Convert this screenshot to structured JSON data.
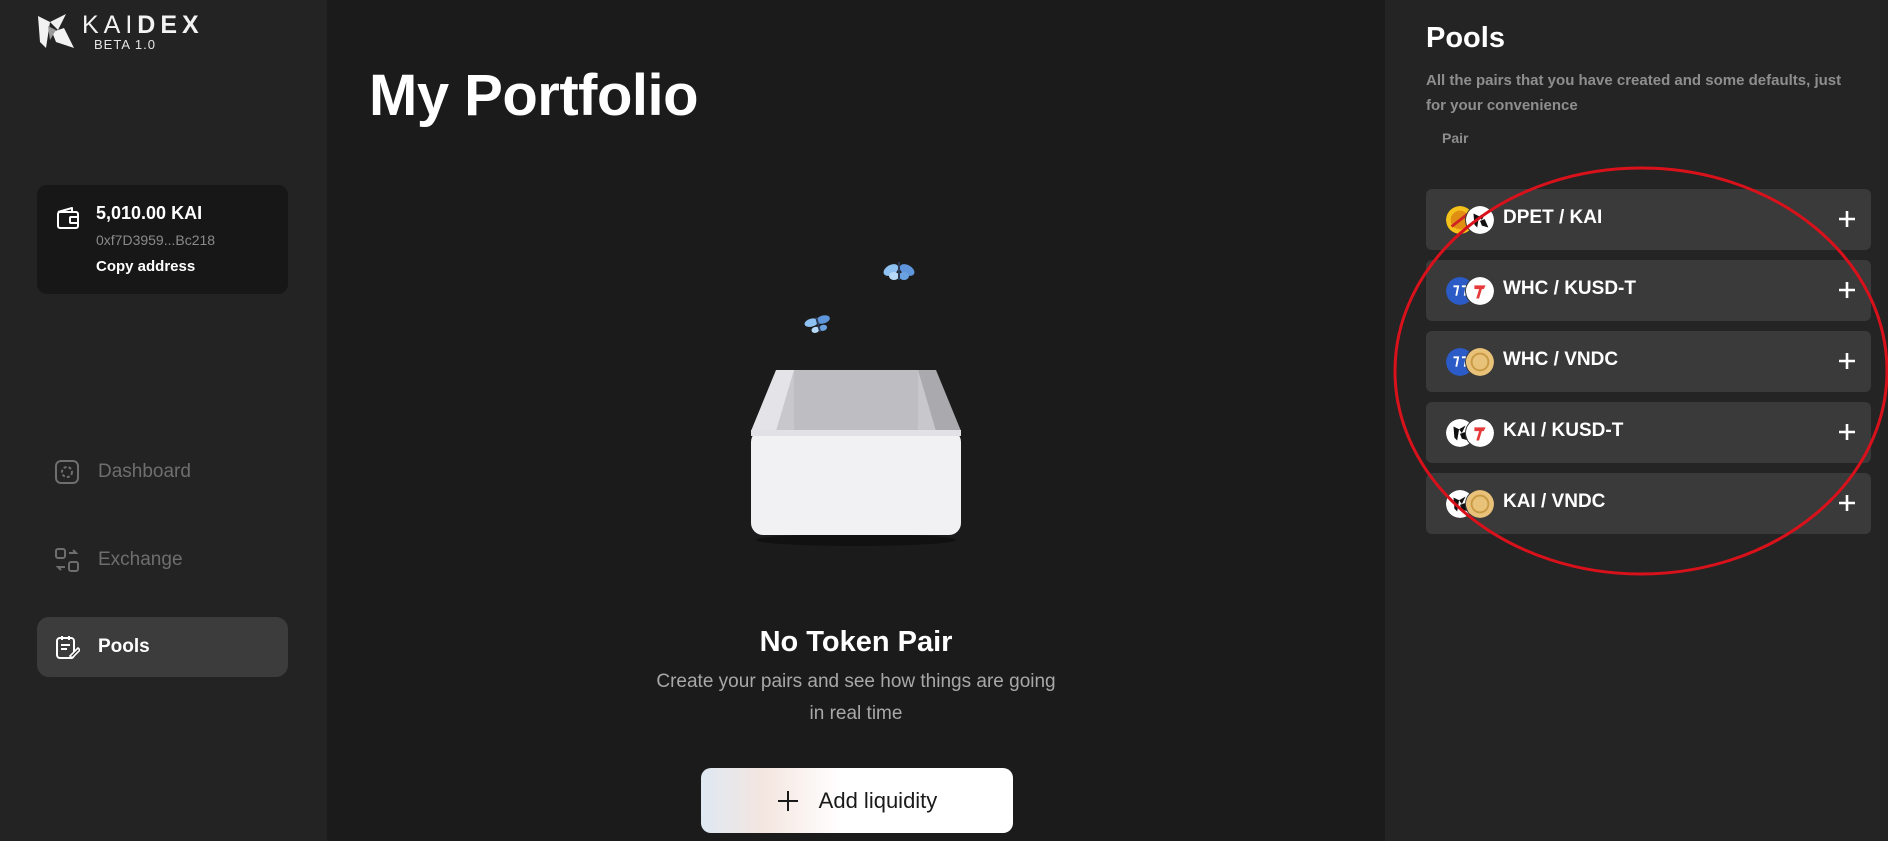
{
  "brand": {
    "name_light": "KAI",
    "name_bold": "DEX",
    "version": "BETA 1.0"
  },
  "wallet": {
    "balance": "5,010.00 KAI",
    "address": "0xf7D3959...Bc218",
    "copy_label": "Copy address"
  },
  "nav": {
    "items": [
      {
        "label": "Dashboard",
        "icon": "dashboard-icon",
        "active": false
      },
      {
        "label": "Exchange",
        "icon": "exchange-icon",
        "active": false
      },
      {
        "label": "Pools",
        "icon": "pools-icon",
        "active": true
      }
    ]
  },
  "main": {
    "title": "My Portfolio",
    "empty_title": "No Token Pair",
    "empty_text": "Create your pairs and see how things are going in real time",
    "add_button": "Add liquidity"
  },
  "pools_panel": {
    "title": "Pools",
    "subtitle": "All the pairs that you have created and some defaults, just for your convenience",
    "column_header": "Pair",
    "pairs": [
      {
        "label": "DPET / KAI",
        "token_a": "dpet-token-icon",
        "token_b": "kai-token-icon"
      },
      {
        "label": "WHC / KUSD-T",
        "token_a": "whc-token-icon",
        "token_b": "kusd-t-token-icon"
      },
      {
        "label": "WHC / VNDC",
        "token_a": "whc-token-icon",
        "token_b": "vndc-token-icon"
      },
      {
        "label": "KAI / KUSD-T",
        "token_a": "kai-token-icon",
        "token_b": "kusd-t-token-icon"
      },
      {
        "label": "KAI / VNDC",
        "token_a": "kai-token-icon",
        "token_b": "vndc-token-icon"
      }
    ]
  },
  "colors": {
    "annotation": "#d9111b",
    "active_nav": "#3c3c3c",
    "row_bg": "#3a3a3a"
  }
}
